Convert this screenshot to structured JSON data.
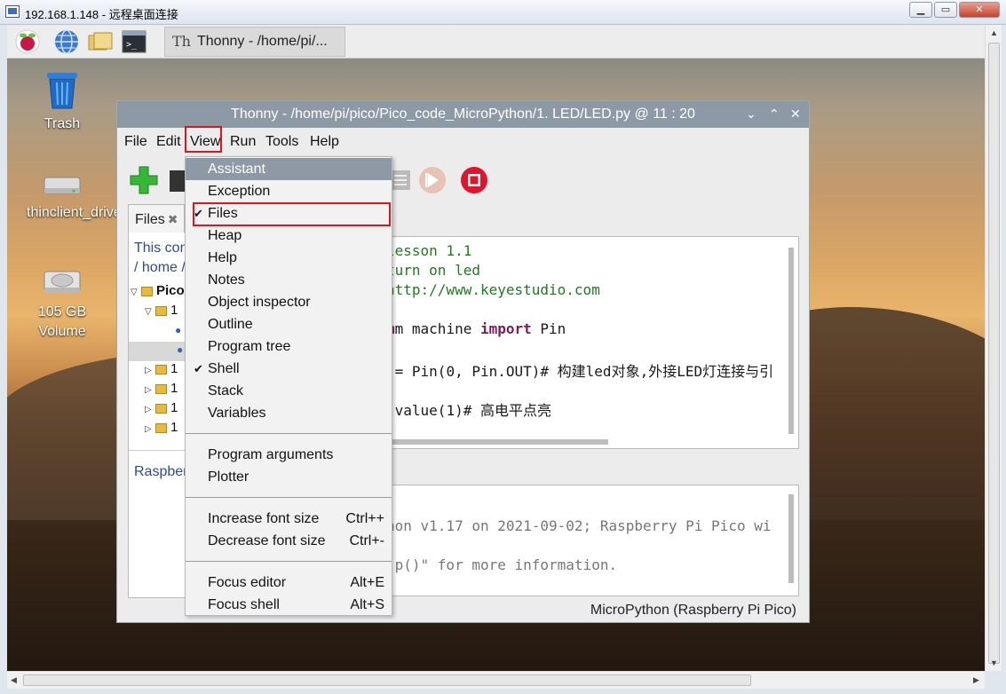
{
  "rdp": {
    "title": "192.168.1.148 - 远程桌面连接",
    "min": "▁",
    "max": "▭",
    "close": "✕"
  },
  "panel": {
    "task_label": "Thonny  -  /home/pi/..."
  },
  "desktop": {
    "icons": [
      {
        "label": "Trash"
      },
      {
        "label": "thinclient_drives"
      },
      {
        "label": "105 GB Volume"
      }
    ]
  },
  "thonny": {
    "title": "Thonny  -  /home/pi/pico/Pico_code_MicroPython/1. LED/LED.py  @  11 : 20",
    "menu": [
      "File",
      "Edit",
      "View",
      "Run",
      "Tools",
      "Help"
    ],
    "files_tab": "Files",
    "files_pane": {
      "this_computer": "This con",
      "path": "/ home /",
      "tree": [
        "Pico",
        "1",
        "",
        "",
        "1",
        "1",
        "1",
        "1"
      ],
      "raspberry": "Raspber"
    },
    "code_lines": [
      {
        "a": "",
        "kw": "",
        "b": "lesson 1.1"
      },
      {
        "a": "",
        "kw": "",
        "b": "turn on led"
      },
      {
        "a": "",
        "kw": "",
        "b": "http://www.keyestudio.com"
      },
      {
        "a": "m machine ",
        "kw": "import",
        "b": " Pin"
      },
      {
        "a": " = Pin(",
        "kw": "",
        "b": "0, Pin.OUT)# 构建led对象,外接LED灯连接与引"
      },
      {
        "a": ".value(",
        "kw": "",
        "b": "1)# 高电平点亮"
      }
    ],
    "shell_lines": [
      "hon v1.17 on 2021-09-02; Raspberry Pi Pico wi",
      ")",
      ".p()\" for more information."
    ],
    "status": "MicroPython (Raspberry Pi Pico)"
  },
  "view_menu": {
    "items": [
      {
        "label": "Assistant",
        "checked": false,
        "accel": ""
      },
      {
        "label": "Exception",
        "checked": false,
        "accel": ""
      },
      {
        "label": "Files",
        "checked": true,
        "accel": ""
      },
      {
        "label": "Heap",
        "checked": false,
        "accel": ""
      },
      {
        "label": "Help",
        "checked": false,
        "accel": ""
      },
      {
        "label": "Notes",
        "checked": false,
        "accel": ""
      },
      {
        "label": "Object inspector",
        "checked": false,
        "accel": ""
      },
      {
        "label": "Outline",
        "checked": false,
        "accel": ""
      },
      {
        "label": "Program tree",
        "checked": false,
        "accel": ""
      },
      {
        "label": "Shell",
        "checked": true,
        "accel": ""
      },
      {
        "label": "Stack",
        "checked": false,
        "accel": ""
      },
      {
        "label": "Variables",
        "checked": false,
        "accel": ""
      },
      {
        "label": "Program arguments",
        "checked": false,
        "accel": ""
      },
      {
        "label": "Plotter",
        "checked": false,
        "accel": ""
      },
      {
        "label": "Increase font size",
        "checked": false,
        "accel": "Ctrl++"
      },
      {
        "label": "Decrease font size",
        "checked": false,
        "accel": "Ctrl+-"
      },
      {
        "label": "Focus editor",
        "checked": false,
        "accel": "Alt+E"
      },
      {
        "label": "Focus shell",
        "checked": false,
        "accel": "Alt+S"
      }
    ],
    "check_glyph": "✔"
  },
  "colors": {
    "highlight": "#8d9aa6",
    "annotation": "#e0141c",
    "stop_button": "#e0142a",
    "new_button": "#37b737"
  }
}
